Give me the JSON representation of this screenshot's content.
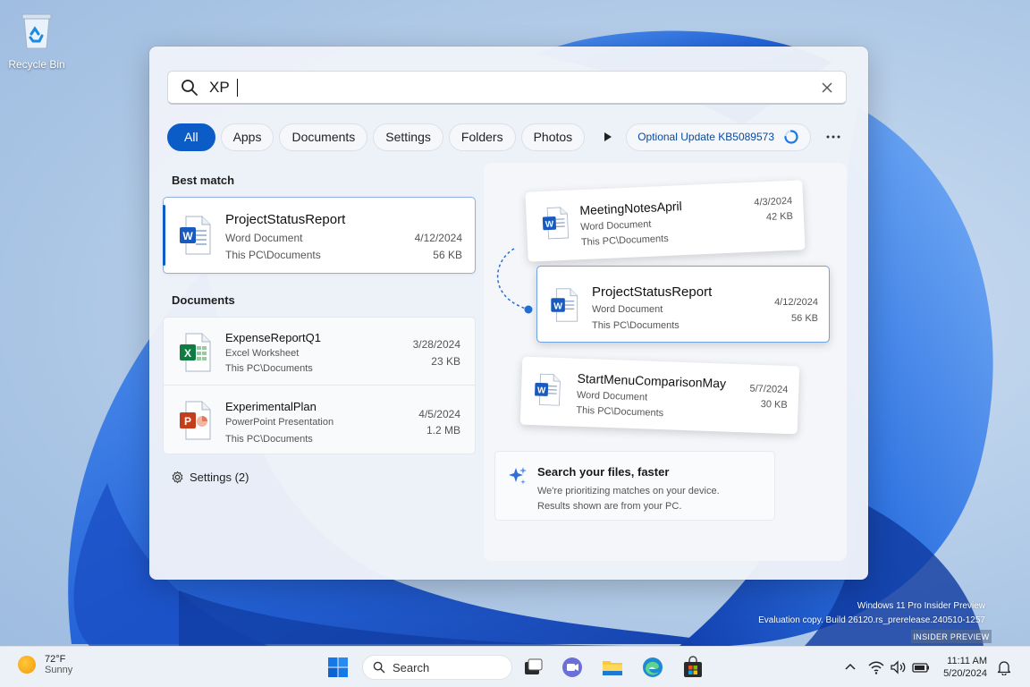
{
  "desktop": {
    "recycle_bin_label": "Recycle Bin"
  },
  "search": {
    "query": "XP",
    "filters": [
      "All",
      "Apps",
      "Documents",
      "Settings",
      "Folders",
      "Photos"
    ],
    "active_filter": "All",
    "update_chip": "Optional Update KB5089573"
  },
  "results": {
    "best_match_heading": "Best match",
    "best": {
      "name": "ProjectStatusReport",
      "type": "Word Document",
      "location": "This PC\\Documents",
      "date": "4/12/2024",
      "size": "56 KB",
      "icon": "word-icon"
    },
    "documents_heading": "Documents",
    "documents": [
      {
        "name": "ExpenseReportQ1",
        "type": "Excel Worksheet",
        "location": "This PC\\Documents",
        "date": "3/28/2024",
        "size": "23 KB",
        "icon": "excel-icon"
      },
      {
        "name": "ExperimentalPlan",
        "type": "PowerPoint Presentation",
        "location": "This PC\\Documents",
        "date": "4/5/2024",
        "size": "1.2 MB",
        "icon": "powerpoint-icon"
      }
    ],
    "settings_label": "Settings (2)"
  },
  "preview": {
    "cards": [
      {
        "name": "MeetingNotesApril",
        "type": "Word Document",
        "location": "This PC\\Documents",
        "date": "4/3/2024",
        "size": "42 KB"
      },
      {
        "name": "ProjectStatusReport",
        "type": "Word Document",
        "location": "This PC\\Documents",
        "date": "4/12/2024",
        "size": "56 KB"
      },
      {
        "name": "StartMenuComparisonMay",
        "type": "Word Document",
        "location": "This PC\\Documents",
        "date": "5/7/2024",
        "size": "30 KB"
      }
    ],
    "info": {
      "title": "Search your files, faster",
      "line1": "We're prioritizing matches on your device.",
      "line2": "Results shown are from your PC."
    }
  },
  "watermark": {
    "line1": "Windows 11 Pro Insider Preview",
    "line2": "Evaluation copy. Build 26120.rs_prerelease.240510-1257",
    "badge": "INSIDER PREVIEW"
  },
  "taskbar": {
    "weather_temp": "72°F",
    "weather_cond": "Sunny",
    "search_label": "Search",
    "time": "11:11 AM",
    "date": "5/20/2024"
  },
  "colors": {
    "accent": "#0b5cc7",
    "word": "#185abd",
    "excel": "#107c41",
    "powerpoint": "#c43e1c"
  }
}
